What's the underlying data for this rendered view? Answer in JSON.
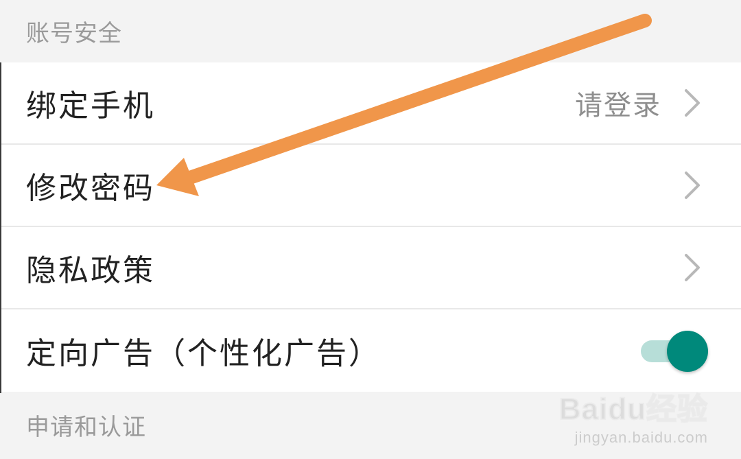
{
  "sections": {
    "account_security": {
      "header": "账号安全"
    },
    "apply_verify": {
      "header": "申请和认证"
    }
  },
  "rows": {
    "bind_phone": {
      "label": "绑定手机",
      "value": "请登录",
      "icon": "chevron-right-icon"
    },
    "change_password": {
      "label": "修改密码",
      "icon": "chevron-right-icon"
    },
    "privacy_policy": {
      "label": "隐私政策",
      "icon": "chevron-right-icon"
    },
    "targeted_ads": {
      "label": "定向广告（个性化广告）",
      "toggle_on": true
    }
  },
  "colors": {
    "toggle_thumb": "#00897b",
    "toggle_track": "#b7ded8",
    "arrow": "#f0964a",
    "section_bg": "#f3f3f3",
    "row_bg": "#ffffff"
  },
  "watermark": {
    "logo": "Baidu经验",
    "url": "jingyan.baidu.com"
  }
}
